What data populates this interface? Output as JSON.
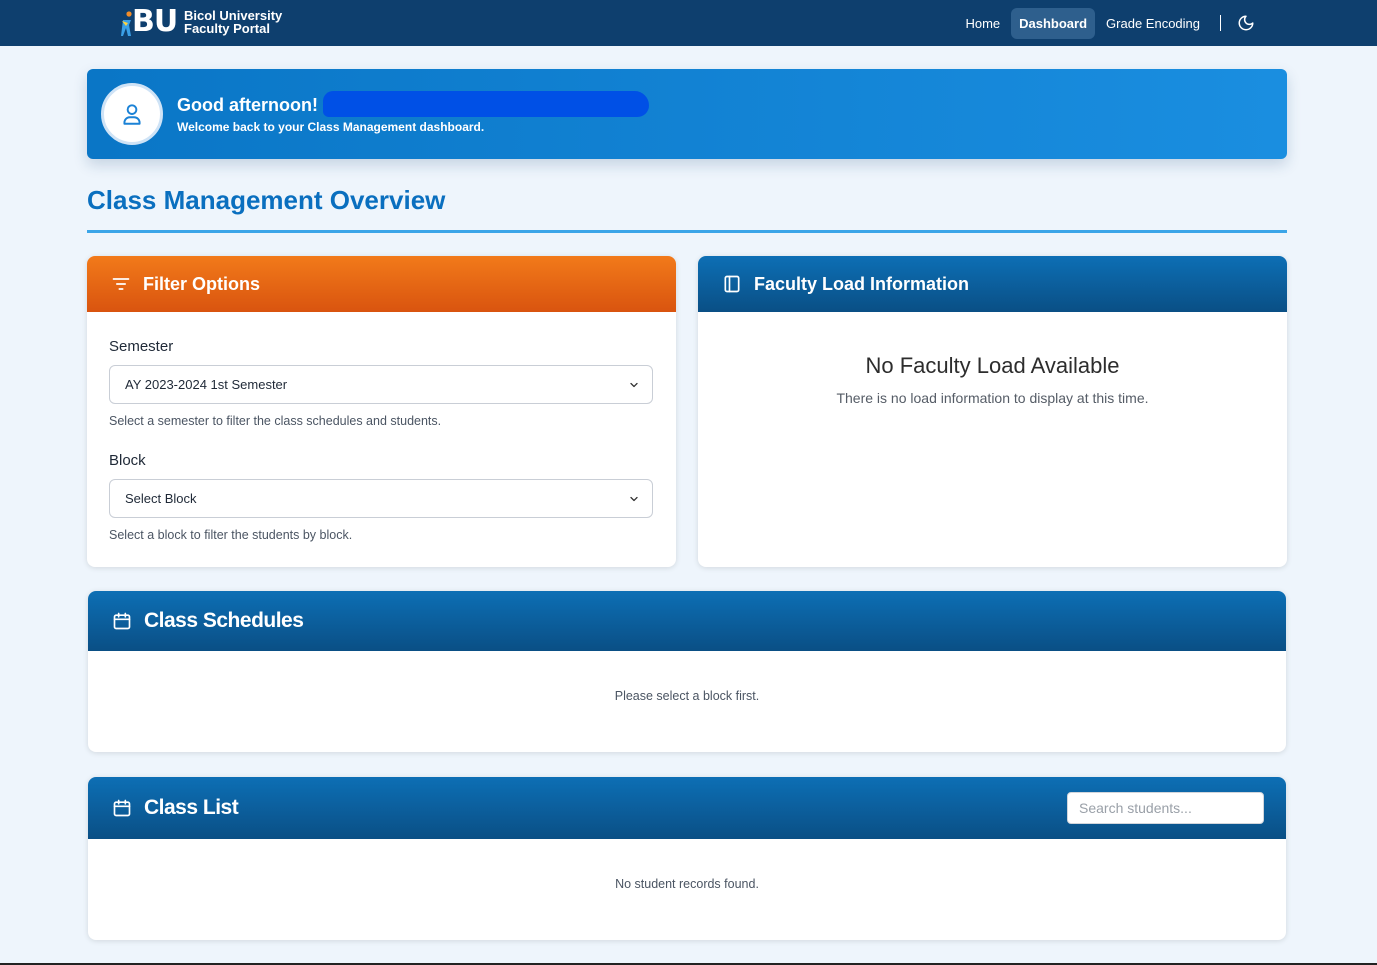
{
  "nav": {
    "logo_letters": "BU",
    "logo_line1": "Bicol University",
    "logo_line2": "Faculty Portal",
    "links": [
      {
        "label": "Home",
        "active": false
      },
      {
        "label": "Dashboard",
        "active": true
      },
      {
        "label": "Grade Encoding",
        "active": false
      }
    ],
    "theme_icon": "moon-icon"
  },
  "greeting": {
    "title": "Good afternoon!",
    "subtitle": "Welcome back to your Class Management dashboard.",
    "avatar_icon": "user-icon"
  },
  "page": {
    "title": "Class Management Overview"
  },
  "filter": {
    "header": "Filter Options",
    "icon": "filter-icon",
    "semester_label": "Semester",
    "semester_value": "AY 2023-2024 1st Semester",
    "semester_hint": "Select a semester to filter the class schedules and students.",
    "block_label": "Block",
    "block_value": "Select Block",
    "block_hint": "Select a block to filter the students by block."
  },
  "faculty_load": {
    "header": "Faculty Load Information",
    "icon": "sidebar-panel-icon",
    "empty_title": "No Faculty Load Available",
    "empty_sub": "There is no load information to display at this time."
  },
  "schedules": {
    "header": "Class Schedules",
    "icon": "calendar-icon",
    "empty": "Please select a block first."
  },
  "class_list": {
    "header": "Class List",
    "icon": "calendar-icon",
    "search_placeholder": "Search students...",
    "empty": "No student records found."
  },
  "colors": {
    "nav_bg": "#0e3f6e",
    "accent_blue": "#0a6fbf",
    "accent_orange": "#f27a1a"
  }
}
